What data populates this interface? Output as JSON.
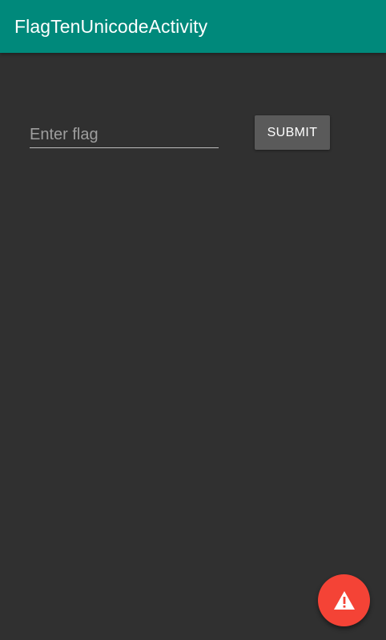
{
  "toolbar": {
    "title": "FlagTenUnicodeActivity",
    "color": "#00897B"
  },
  "form": {
    "flag_input": {
      "value": "",
      "placeholder": "Enter flag"
    },
    "submit_label": "SUBMIT"
  },
  "fab": {
    "icon": "warning-icon",
    "color": "#F44336"
  },
  "colors": {
    "background": "#303030",
    "button": "#5a5a5a"
  }
}
